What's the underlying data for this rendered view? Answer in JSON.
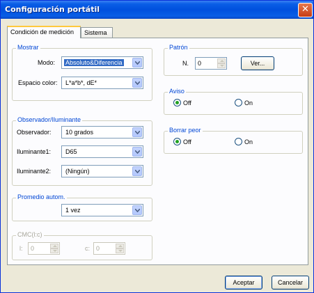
{
  "window": {
    "title": "Configuración portátil",
    "close_icon": "close-icon"
  },
  "tabs": [
    {
      "label": "Condición de medición"
    },
    {
      "label": "Sistema"
    }
  ],
  "mostrar": {
    "title": "Mostrar",
    "modo": {
      "label": "Modo:",
      "value": "Absoluto&Diferencia"
    },
    "espacio": {
      "label": "Espacio color:",
      "value": "L*a*b*, dE*"
    }
  },
  "observador_iluminante": {
    "title": "Observador/Iluminante",
    "observador": {
      "label": "Observador:",
      "value": "10 grados"
    },
    "iluminante1": {
      "label": "Iluminante1:",
      "value": "D65"
    },
    "iluminante2": {
      "label": "Iluminante2:",
      "value": "(Ningún)"
    }
  },
  "promedio": {
    "title": "Promedio autom.",
    "value": "1 vez"
  },
  "cmc": {
    "title": "CMC(l:c)",
    "l_label": "l:",
    "l_value": "0",
    "c_label": "c:",
    "c_value": "0"
  },
  "patron": {
    "title": "Patrón",
    "n_label": "N.",
    "n_value": "0",
    "ver_label": "Ver..."
  },
  "aviso": {
    "title": "Aviso",
    "off_label": "Off",
    "on_label": "On",
    "selected": "off"
  },
  "borrar_peor": {
    "title": "Borrar peor",
    "off_label": "Off",
    "on_label": "On",
    "selected": "off"
  },
  "footer": {
    "aceptar_label": "Aceptar",
    "cancelar_label": "Cancelar"
  }
}
